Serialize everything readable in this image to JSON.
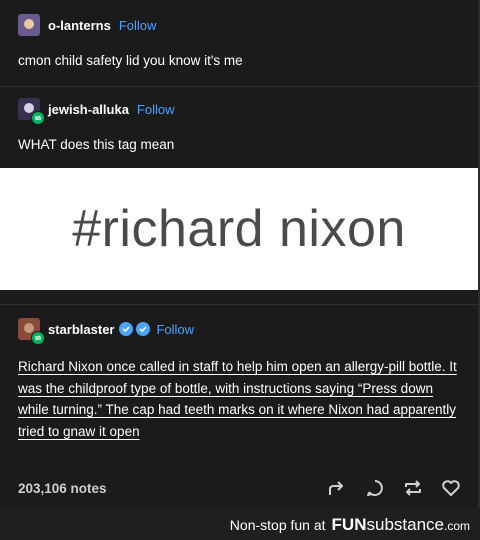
{
  "posts": [
    {
      "username": "o-lanterns",
      "follow": "Follow",
      "text": "cmon child safety lid you know it's me"
    },
    {
      "username": "jewish-alluka",
      "follow": "Follow",
      "text": "WHAT does this tag mean",
      "tag": "#richard nixon"
    },
    {
      "username": "starblaster",
      "follow": "Follow",
      "text": "Richard Nixon once called in staff to help him open an allergy-pill bottle. It was the childproof type of bottle, with instructions saying “Press down while turning.” The cap had teeth marks on it where Nixon had apparently tried to gnaw it open"
    }
  ],
  "footer": {
    "notes": "203,106 notes"
  },
  "icons": [
    "share-icon",
    "reply-icon",
    "reblog-icon",
    "like-icon",
    "verified-icon"
  ],
  "banner": {
    "text": "Non-stop fun at",
    "brand_a": "FUN",
    "brand_b": "substance",
    "brand_c": ".com"
  },
  "colors": {
    "follow": "#4aa3ff",
    "badge": "#00b35e",
    "background": "#1b1b1b"
  }
}
